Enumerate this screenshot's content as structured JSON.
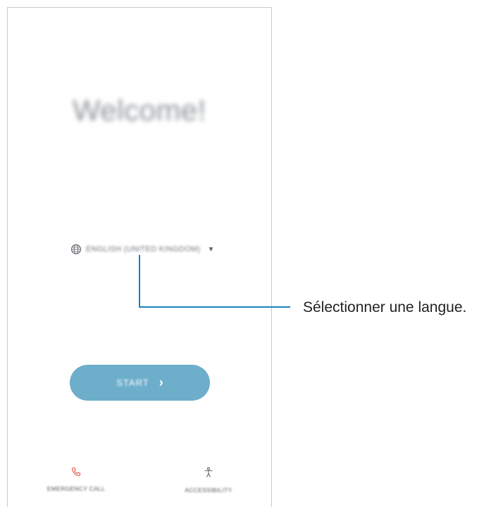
{
  "welcome_title": "Welcome!",
  "language": {
    "icon": "globe-icon",
    "selected": "ENGLISH (UNITED KINGDOM)",
    "dropdown_icon": "caret-down-icon"
  },
  "start_button": {
    "label": "START",
    "icon": "chevron-right-icon",
    "color": "#6daecb"
  },
  "bottom_bar": {
    "emergency": {
      "icon": "phone-icon",
      "label": "EMERGENCY CALL",
      "icon_color": "#e2574c"
    },
    "accessibility": {
      "icon": "accessibility-icon",
      "label": "ACCESSIBILITY"
    }
  },
  "callout": {
    "text": "Sélectionner une langue.",
    "line_color": "#1a82b9"
  }
}
